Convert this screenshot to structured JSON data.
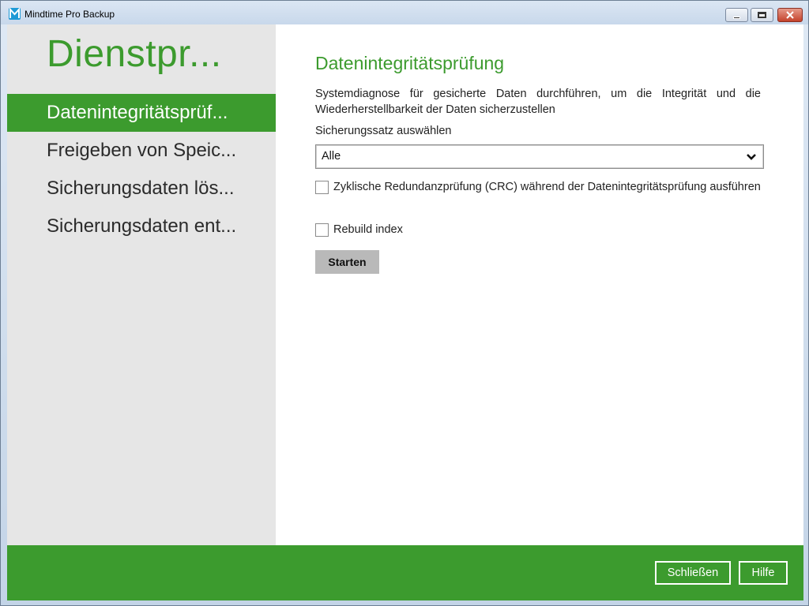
{
  "window": {
    "title": "Mindtime Pro Backup",
    "accent_color": "#3c9b2e",
    "icon": "mindtime-logo-icon"
  },
  "sidebar": {
    "title": "Dienstpr...",
    "items": [
      {
        "label": "Datenintegritätsprüf...",
        "active": true
      },
      {
        "label": "Freigeben von Speic...",
        "active": false
      },
      {
        "label": "Sicherungsdaten lös...",
        "active": false
      },
      {
        "label": "Sicherungsdaten ent...",
        "active": false
      }
    ]
  },
  "content": {
    "title": "Datenintegritätsprüfung",
    "description": "Systemdiagnose für gesicherte Daten durchführen, um die Integrität und die Wiederherstellbarkeit der Daten sicherzustellen",
    "backup_set_label": "Sicherungssatz auswählen",
    "backup_set_value": "Alle",
    "crc_label": "Zyklische Redundanzprüfung (CRC) während der Datenintegritätsprüfung ausführen",
    "crc_checked": false,
    "rebuild_label": "Rebuild index",
    "rebuild_checked": false,
    "start_button": "Starten"
  },
  "footer": {
    "close_button": "Schließen",
    "help_button": "Hilfe"
  }
}
